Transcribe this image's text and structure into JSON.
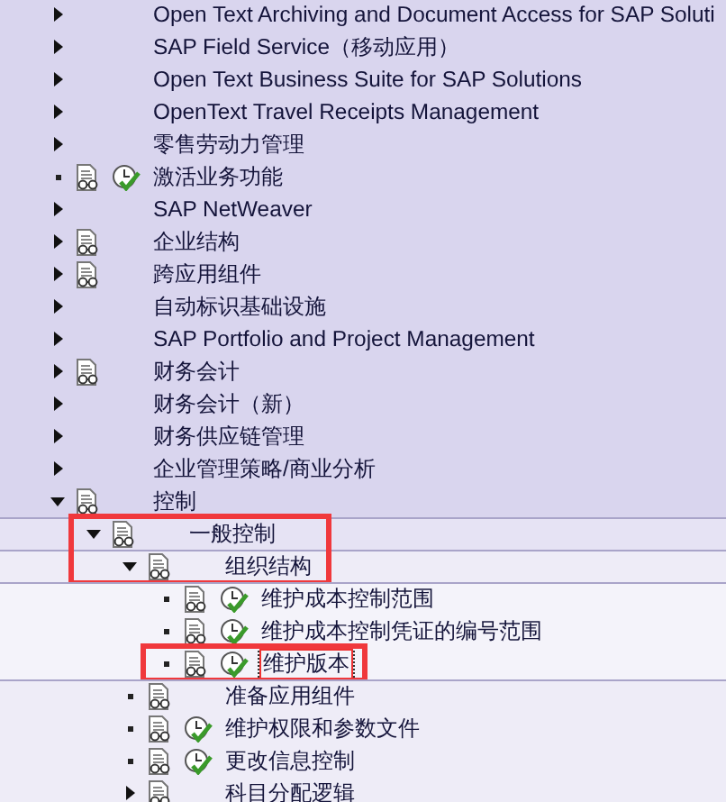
{
  "tree": [
    {
      "label": "Open Text Archiving and Document Access for SAP Soluti",
      "expandable": true,
      "expanded": false,
      "doc": false,
      "activity": false
    },
    {
      "label": "SAP Field Service（移动应用）",
      "expandable": true,
      "expanded": false,
      "doc": false,
      "activity": false
    },
    {
      "label": "Open Text Business Suite for SAP Solutions",
      "expandable": true,
      "expanded": false,
      "doc": false,
      "activity": false
    },
    {
      "label": "OpenText Travel Receipts Management",
      "expandable": true,
      "expanded": false,
      "doc": false,
      "activity": false
    },
    {
      "label": "零售劳动力管理",
      "expandable": true,
      "expanded": false,
      "doc": false,
      "activity": false
    },
    {
      "label": "激活业务功能",
      "expandable": false,
      "doc": true,
      "activity": true
    },
    {
      "label": "SAP NetWeaver",
      "expandable": true,
      "expanded": false,
      "doc": false,
      "activity": false
    },
    {
      "label": "企业结构",
      "expandable": true,
      "expanded": false,
      "doc": true,
      "activity": false
    },
    {
      "label": "跨应用组件",
      "expandable": true,
      "expanded": false,
      "doc": true,
      "activity": false
    },
    {
      "label": "自动标识基础设施",
      "expandable": true,
      "expanded": false,
      "doc": false,
      "activity": false
    },
    {
      "label": "SAP Portfolio and Project Management",
      "expandable": true,
      "expanded": false,
      "doc": false,
      "activity": false
    },
    {
      "label": "财务会计",
      "expandable": true,
      "expanded": false,
      "doc": true,
      "activity": false
    },
    {
      "label": "财务会计（新）",
      "expandable": true,
      "expanded": false,
      "doc": false,
      "activity": false
    },
    {
      "label": "财务供应链管理",
      "expandable": true,
      "expanded": false,
      "doc": false,
      "activity": false
    },
    {
      "label": "企业管理策略/商业分析",
      "expandable": true,
      "expanded": false,
      "doc": false,
      "activity": false
    },
    {
      "label": "控制",
      "expandable": true,
      "expanded": true,
      "doc": true,
      "activity": false,
      "children": [
        {
          "label": "一般控制",
          "expandable": true,
          "expanded": true,
          "doc": true,
          "activity": false,
          "boxed": true,
          "children": [
            {
              "label": "组织结构",
              "expandable": true,
              "expanded": true,
              "doc": true,
              "activity": false,
              "boxed": true,
              "children": [
                {
                  "label": "维护成本控制范围",
                  "expandable": false,
                  "doc": true,
                  "activity": true
                },
                {
                  "label": "维护成本控制凭证的编号范围",
                  "expandable": false,
                  "doc": true,
                  "activity": true
                },
                {
                  "label": "维护版本",
                  "expandable": false,
                  "doc": true,
                  "activity": true,
                  "boxed": true,
                  "selected": true
                }
              ]
            },
            {
              "label": "准备应用组件",
              "expandable": false,
              "doc": true,
              "activity": false
            },
            {
              "label": "维护权限和参数文件",
              "expandable": false,
              "doc": true,
              "activity": true
            },
            {
              "label": "更改信息控制",
              "expandable": false,
              "doc": true,
              "activity": true
            },
            {
              "label": "科目分配逻辑",
              "expandable": true,
              "expanded": false,
              "doc": true,
              "activity": false
            }
          ]
        }
      ]
    }
  ]
}
